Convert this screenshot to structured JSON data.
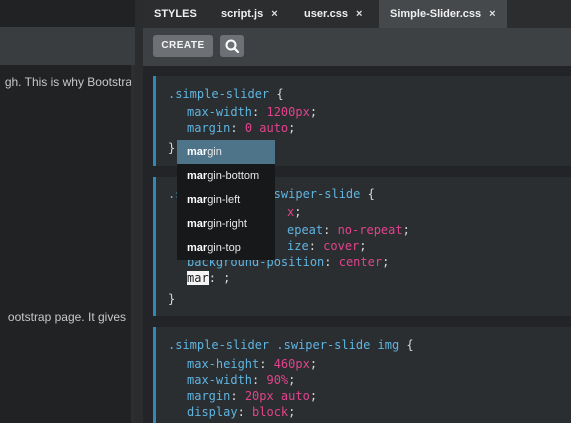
{
  "preview": {
    "line1": "gh. This is why Bootstra",
    "line2": "ootstrap page. It gives"
  },
  "tabs": [
    {
      "label": "STYLES",
      "closable": false
    },
    {
      "label": "script.js",
      "closable": true
    },
    {
      "label": "user.css",
      "closable": true
    },
    {
      "label": "Simple-Slider.css",
      "closable": true,
      "active": true
    }
  ],
  "tab_close_glyph": "×",
  "toolbar": {
    "create_label": "CREATE",
    "search_icon": "search-icon"
  },
  "code": {
    "b1_l1_sel": ".simple-slider",
    "b1_l1_brace": " {",
    "b1_l2_prop": "max-width",
    "b1_l2_val": "1200px",
    "b1_l3_prop": "margin",
    "b1_l3_val": "0 auto",
    "b1_l4": "}",
    "b2_l1_sel": ".s",
    "b2_l1_sel2": ".swiper-slide",
    "b2_l1_brace": " {",
    "b2_l2_val": "x",
    "b2_l3_prop": "epeat",
    "b2_l3_val": "no-repeat",
    "b2_l4_prop": "ize",
    "b2_l4_val": "cover",
    "b2_l5_prop": "background-position",
    "b2_l5_val": "center",
    "b2_l6_word": "mar",
    "b2_l6_rest": ": ;",
    "b2_l7": "}",
    "b3_l1_sel": ".simple-slider .swiper-slide img",
    "b3_l1_brace": " {",
    "b3_l2_prop": "max-height",
    "b3_l2_val": "460px",
    "b3_l3_prop": "max-width",
    "b3_l3_val": "90%",
    "b3_l4_prop": "margin",
    "b3_l4_val": "20px auto",
    "b3_l5_prop": "display",
    "b3_l5_val": "block"
  },
  "punct": {
    "colon": ": ",
    "semicolon": ";"
  },
  "autocomplete": {
    "match": "mar",
    "items": [
      "gin",
      "gin-bottom",
      "gin-left",
      "gin-right",
      "gin-top"
    ],
    "selected_index": 0
  },
  "colors": {
    "accent": "#2d8ab8",
    "property": "#5fb4e0",
    "value": "#e0448c",
    "selection": "#4e7489"
  }
}
